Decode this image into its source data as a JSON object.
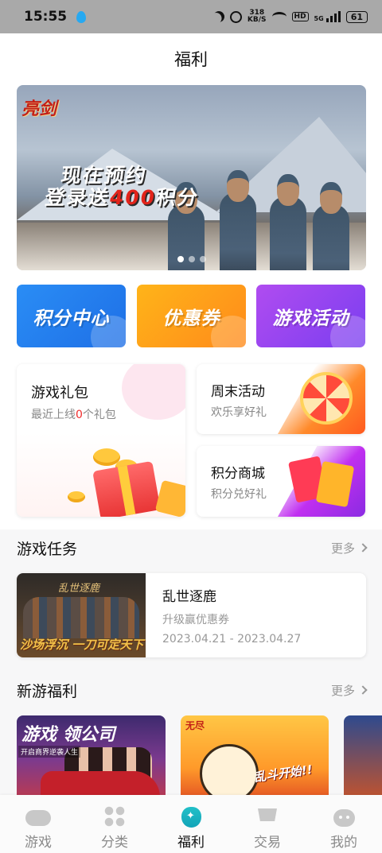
{
  "status_bar": {
    "time": "15:55",
    "net_speed_value": "318",
    "net_speed_unit": "KB/S",
    "hd": "HD",
    "signal": "5G",
    "battery": "61"
  },
  "header": {
    "title": "福利"
  },
  "banner": {
    "logo_text": "亮剑",
    "promo_line1": "现在预约",
    "promo_line2_prefix": "登录送",
    "promo_line2_highlight": "400",
    "promo_line2_suffix": "积分",
    "page_count": 3,
    "active_index": 0
  },
  "entries": [
    {
      "label": "积分中心",
      "color": "#1e7ef0"
    },
    {
      "label": "优惠券",
      "color": "#ff9a1a"
    },
    {
      "label": "游戏活动",
      "color": "#9444ef"
    }
  ],
  "cards": {
    "gift": {
      "title": "游戏礼包",
      "sub_prefix": "最近上线",
      "sub_count": "0",
      "sub_suffix": "个礼包"
    },
    "weekend": {
      "title": "周末活动",
      "sub": "欢乐享好礼"
    },
    "mall": {
      "title": "积分商城",
      "sub": "积分兑好礼"
    }
  },
  "game_tasks": {
    "title": "游戏任务",
    "more": "更多",
    "items": [
      {
        "thumb_title": "乱世逐鹿",
        "thumb_slogan": "沙场浮沉 一刀可定天下",
        "name": "乱世逐鹿",
        "desc": "升级赢优惠券",
        "date": "2023.04.21 - 2023.04.27"
      }
    ]
  },
  "new_games": {
    "title": "新游福利",
    "more": "更多",
    "items": [
      {
        "thumb_title": "游戏 领公司",
        "thumb_sub": "开启商界逆袭人生"
      },
      {
        "thumb_tag": "无尽",
        "thumb_slogan": "乱斗开始!!"
      },
      {
        "thumb_title": ""
      }
    ]
  },
  "tabbar": {
    "active": "福利",
    "items": [
      {
        "label": "游戏",
        "icon": "gamepad-icon"
      },
      {
        "label": "分类",
        "icon": "grid-icon"
      },
      {
        "label": "福利",
        "icon": "welfare-bag-icon"
      },
      {
        "label": "交易",
        "icon": "cart-icon"
      },
      {
        "label": "我的",
        "icon": "robot-icon"
      }
    ]
  },
  "colors": {
    "accent_red": "#f02b2b",
    "tab_active_icon": "#12a4b8",
    "muted_text": "#999999"
  }
}
